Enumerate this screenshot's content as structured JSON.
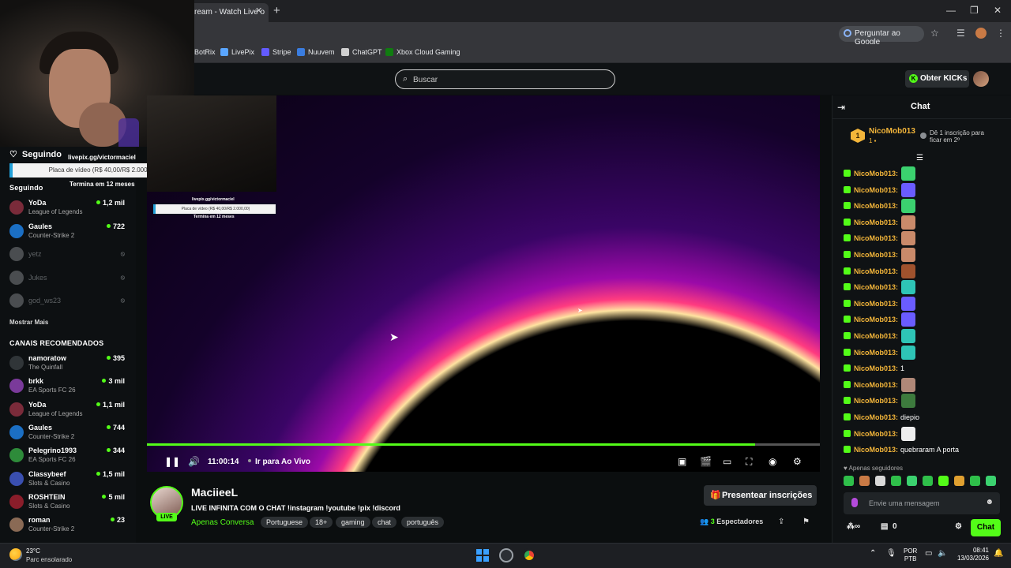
{
  "browser": {
    "tab_title": "ream - Watch Live o",
    "google_chip": "Perguntar ao Google",
    "bookmarks": [
      {
        "label": "BotRix",
        "color": "#6b6b6b"
      },
      {
        "label": "LivePix",
        "color": "#5aa6ff"
      },
      {
        "label": "Stripe",
        "color": "#635bff"
      },
      {
        "label": "Nuuvem",
        "color": "#3a7de0"
      },
      {
        "label": "ChatGPT",
        "color": "#d0d0d0"
      },
      {
        "label": "Xbox Cloud Gaming",
        "color": "#107c10"
      }
    ]
  },
  "header": {
    "search_placeholder": "Buscar",
    "get_kicks": "Obter KICKs"
  },
  "overlay": {
    "livepix_url": "livepix.gg/victormaciel",
    "goal_text": "Placa de vídeo (R$ 40,00/R$ 2.000,00)",
    "goal_end": "Termina em 12 meses"
  },
  "sidebar": {
    "following_header": "Seguindo",
    "following_title": "Seguindo",
    "following": [
      {
        "name": "YoDa",
        "game": "League of Legends",
        "viewers": "1,2 mil",
        "live": true,
        "color": "#7a2b3a"
      },
      {
        "name": "Gaules",
        "game": "Counter-Strike 2",
        "viewers": "722",
        "live": true,
        "color": "#1b6fc4"
      },
      {
        "name": "yetz",
        "game": "",
        "viewers": "",
        "live": false,
        "color": "#4a4d50"
      },
      {
        "name": "Jukes",
        "game": "",
        "viewers": "",
        "live": false,
        "color": "#4a4d50"
      },
      {
        "name": "god_ws23",
        "game": "",
        "viewers": "",
        "live": false,
        "color": "#4a4d50"
      }
    ],
    "show_more": "Mostrar Mais",
    "recommended_title": "CANAIS RECOMENDADOS",
    "recommended": [
      {
        "name": "namoratow",
        "game": "The Quinfall",
        "viewers": "395",
        "color": "#303538"
      },
      {
        "name": "brkk",
        "game": "EA Sports FC 26",
        "viewers": "3 mil",
        "color": "#7a3a9a"
      },
      {
        "name": "YoDa",
        "game": "League of Legends",
        "viewers": "1,1 mil",
        "color": "#7a2b3a"
      },
      {
        "name": "Gaules",
        "game": "Counter-Strike 2",
        "viewers": "744",
        "color": "#1b6fc4"
      },
      {
        "name": "Pelegrino1993",
        "game": "EA Sports FC 26",
        "viewers": "344",
        "color": "#2e8b3a"
      },
      {
        "name": "Classybeef",
        "game": "Slots & Casino",
        "viewers": "1,5 mil",
        "color": "#3a4fb0"
      },
      {
        "name": "ROSHTEIN",
        "game": "Slots & Casino",
        "viewers": "5 mil",
        "color": "#8a1d2a"
      },
      {
        "name": "roman",
        "game": "Counter-Strike 2",
        "viewers": "23",
        "color": "#8a6a55"
      }
    ]
  },
  "player": {
    "time": "11:00:14",
    "go_live": "Ir para Ao Vivo",
    "progress": 0.904
  },
  "stream": {
    "streamer": "MaciieeL",
    "live_label": "LIVE",
    "title": "LIVE INFINITA COM O CHAT !instagram !youtube !pix !discord",
    "category": "Apenas Conversa",
    "tags": [
      "Portuguese",
      "18+",
      "gaming",
      "chat",
      "português"
    ],
    "subscribe_button": "Presentear inscrições",
    "viewer_count": "3",
    "viewer_label": "Espectadores"
  },
  "chat": {
    "title": "Chat",
    "pinned": {
      "rank": "1",
      "user": "NicoMob013",
      "count": "1",
      "hint": "Dê 1 inscrição para ficar em 2º"
    },
    "messages": [
      {
        "user": "NicoMob013",
        "text": "",
        "emote": "#3bd16f"
      },
      {
        "user": "NicoMob013",
        "text": "",
        "emote": "#6a5cff"
      },
      {
        "user": "NicoMob013",
        "text": "",
        "emote": "#3bd16f"
      },
      {
        "user": "NicoMob013",
        "text": "",
        "emote": "#c98a6a"
      },
      {
        "user": "NicoMob013",
        "text": "",
        "emote": "#c98a6a"
      },
      {
        "user": "NicoMob013",
        "text": "",
        "emote": "#c98a6a"
      },
      {
        "user": "NicoMob013",
        "text": "",
        "emote": "#a0522d"
      },
      {
        "user": "NicoMob013",
        "text": "",
        "emote": "#2ec4b6"
      },
      {
        "user": "NicoMob013",
        "text": "",
        "emote": "#6a5cff"
      },
      {
        "user": "NicoMob013",
        "text": "",
        "emote": "#6a5cff"
      },
      {
        "user": "NicoMob013",
        "text": "",
        "emote": "#2ec4b6"
      },
      {
        "user": "NicoMob013",
        "text": "",
        "emote": "#2ec4b6"
      },
      {
        "user": "NicoMob013",
        "text": "1",
        "emote": ""
      },
      {
        "user": "NicoMob013",
        "text": "",
        "emote": "#b08878"
      },
      {
        "user": "NicoMob013",
        "text": "",
        "emote": "#3d7a3d"
      },
      {
        "user": "NicoMob013",
        "text": "diepio",
        "emote": ""
      },
      {
        "user": "NicoMob013",
        "text": "",
        "emote": "#eeeeee"
      },
      {
        "user": "NicoMob013",
        "text": "quebraram A porta",
        "emote": ""
      }
    ],
    "followers_only": "Apenas seguidores",
    "emote_bar": [
      "#2fbf4a",
      "#c97a45",
      "#d8d8d8",
      "#2fbf4a",
      "#3bd16f",
      "#2fbf4a",
      "#53fc18",
      "#e0a030",
      "#2fbf4a",
      "#3bd16f"
    ],
    "input_placeholder": "Envie uma mensagem",
    "kick_balance": "0",
    "send_button": "Chat"
  },
  "taskbar": {
    "temp": "23°C",
    "weather": "Parc ensolarado",
    "lang": "POR",
    "layout": "PTB",
    "time": "08:41",
    "date": "13/03/2026"
  }
}
